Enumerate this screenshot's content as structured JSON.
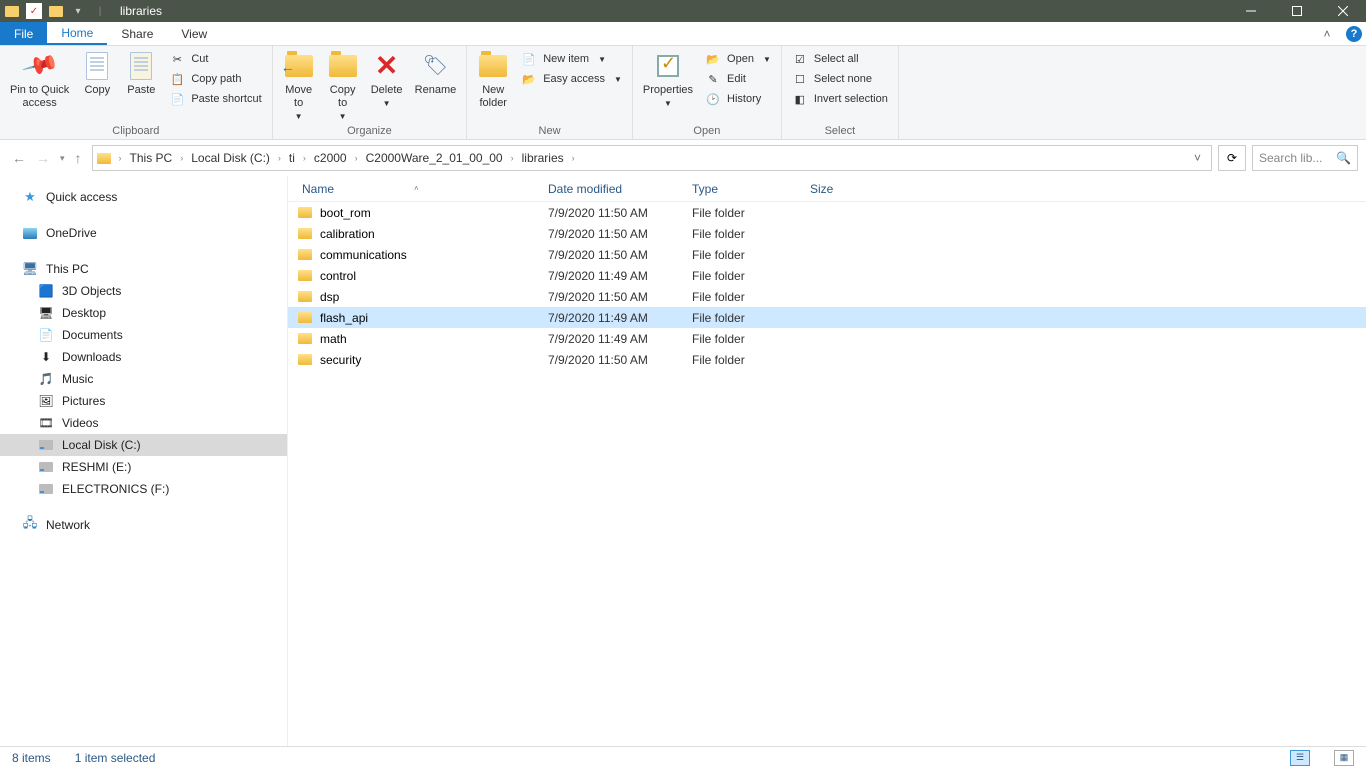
{
  "window": {
    "title": "libraries"
  },
  "tabs": {
    "file": "File",
    "home": "Home",
    "share": "Share",
    "view": "View"
  },
  "ribbon": {
    "clipboard": {
      "label": "Clipboard",
      "pin": "Pin to Quick\naccess",
      "copy": "Copy",
      "paste": "Paste",
      "cut": "Cut",
      "copy_path": "Copy path",
      "paste_shortcut": "Paste shortcut"
    },
    "organize": {
      "label": "Organize",
      "move_to": "Move\nto",
      "copy_to": "Copy\nto",
      "delete": "Delete",
      "rename": "Rename"
    },
    "new": {
      "label": "New",
      "new_folder": "New\nfolder",
      "new_item": "New item",
      "easy_access": "Easy access"
    },
    "open": {
      "label": "Open",
      "properties": "Properties",
      "open": "Open",
      "edit": "Edit",
      "history": "History"
    },
    "select": {
      "label": "Select",
      "select_all": "Select all",
      "select_none": "Select none",
      "invert": "Invert selection"
    }
  },
  "breadcrumb": [
    "This PC",
    "Local Disk (C:)",
    "ti",
    "c2000",
    "C2000Ware_2_01_00_00",
    "libraries"
  ],
  "search": {
    "placeholder": "Search lib..."
  },
  "navpane": {
    "quick_access": "Quick access",
    "onedrive": "OneDrive",
    "this_pc": "This PC",
    "children": [
      "3D Objects",
      "Desktop",
      "Documents",
      "Downloads",
      "Music",
      "Pictures",
      "Videos",
      "Local Disk (C:)",
      "RESHMI (E:)",
      "ELECTRONICS (F:)"
    ],
    "network": "Network"
  },
  "columns": {
    "name": "Name",
    "date": "Date modified",
    "type": "Type",
    "size": "Size"
  },
  "files": [
    {
      "name": "boot_rom",
      "date": "7/9/2020 11:50 AM",
      "type": "File folder",
      "size": ""
    },
    {
      "name": "calibration",
      "date": "7/9/2020 11:50 AM",
      "type": "File folder",
      "size": ""
    },
    {
      "name": "communications",
      "date": "7/9/2020 11:50 AM",
      "type": "File folder",
      "size": ""
    },
    {
      "name": "control",
      "date": "7/9/2020 11:49 AM",
      "type": "File folder",
      "size": ""
    },
    {
      "name": "dsp",
      "date": "7/9/2020 11:50 AM",
      "type": "File folder",
      "size": ""
    },
    {
      "name": "flash_api",
      "date": "7/9/2020 11:49 AM",
      "type": "File folder",
      "size": "",
      "selected": true
    },
    {
      "name": "math",
      "date": "7/9/2020 11:49 AM",
      "type": "File folder",
      "size": ""
    },
    {
      "name": "security",
      "date": "7/9/2020 11:50 AM",
      "type": "File folder",
      "size": ""
    }
  ],
  "status": {
    "items": "8 items",
    "selected": "1 item selected"
  }
}
